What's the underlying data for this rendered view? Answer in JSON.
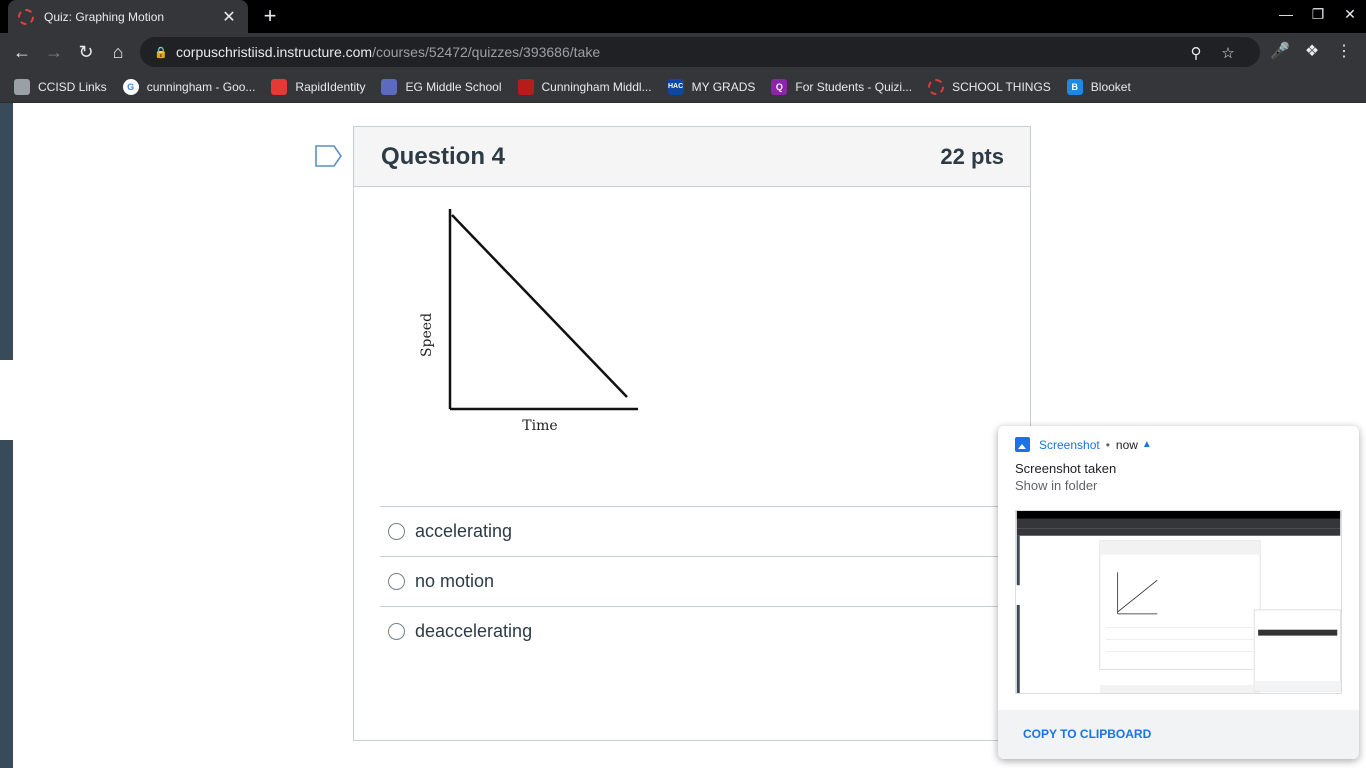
{
  "browser": {
    "tab_title": "Quiz: Graphing Motion",
    "tab_close": "✕",
    "new_tab": "+",
    "url_host": "corpuschristiisd.instructure.com",
    "url_path": "/courses/52472/quizzes/393686/take"
  },
  "bookmarks": [
    {
      "label": "CCISD Links",
      "icon": "folder-icon",
      "color": "#9aa0a6"
    },
    {
      "label": "cunningham - Goo...",
      "icon": "google-icon",
      "color": "#ffffff"
    },
    {
      "label": "RapidIdentity",
      "icon": "rapididentity-icon",
      "color": "#e53935"
    },
    {
      "label": "EG Middle School",
      "icon": "school-icon",
      "color": "#5c6bc0"
    },
    {
      "label": "Cunningham Middl...",
      "icon": "cunningham-icon",
      "color": "#b71c1c"
    },
    {
      "label": "MY GRADS",
      "icon": "hac-icon",
      "color": "#0d47a1"
    },
    {
      "label": "For Students - Quizi...",
      "icon": "quizizz-icon",
      "color": "#8e24aa"
    },
    {
      "label": "SCHOOL THINGS",
      "icon": "school-things-icon",
      "color": "#e53935"
    },
    {
      "label": "Blooket",
      "icon": "blooket-icon",
      "color": "#1e88e5"
    }
  ],
  "question": {
    "title": "Question 4",
    "points": "22 pts",
    "graph_ylabel": "Speed",
    "graph_xlabel": "Time",
    "answers": [
      "accelerating",
      "no motion",
      "deaccelerating"
    ]
  },
  "notification": {
    "source": "Screenshot",
    "dot": "•",
    "time": "now",
    "title": "Screenshot taken",
    "subtitle": "Show in folder",
    "action": "COPY TO CLIPBOARD"
  },
  "colors": {
    "accent": "#1a73e8",
    "rail": "#394b58",
    "text": "#2d3b45"
  }
}
